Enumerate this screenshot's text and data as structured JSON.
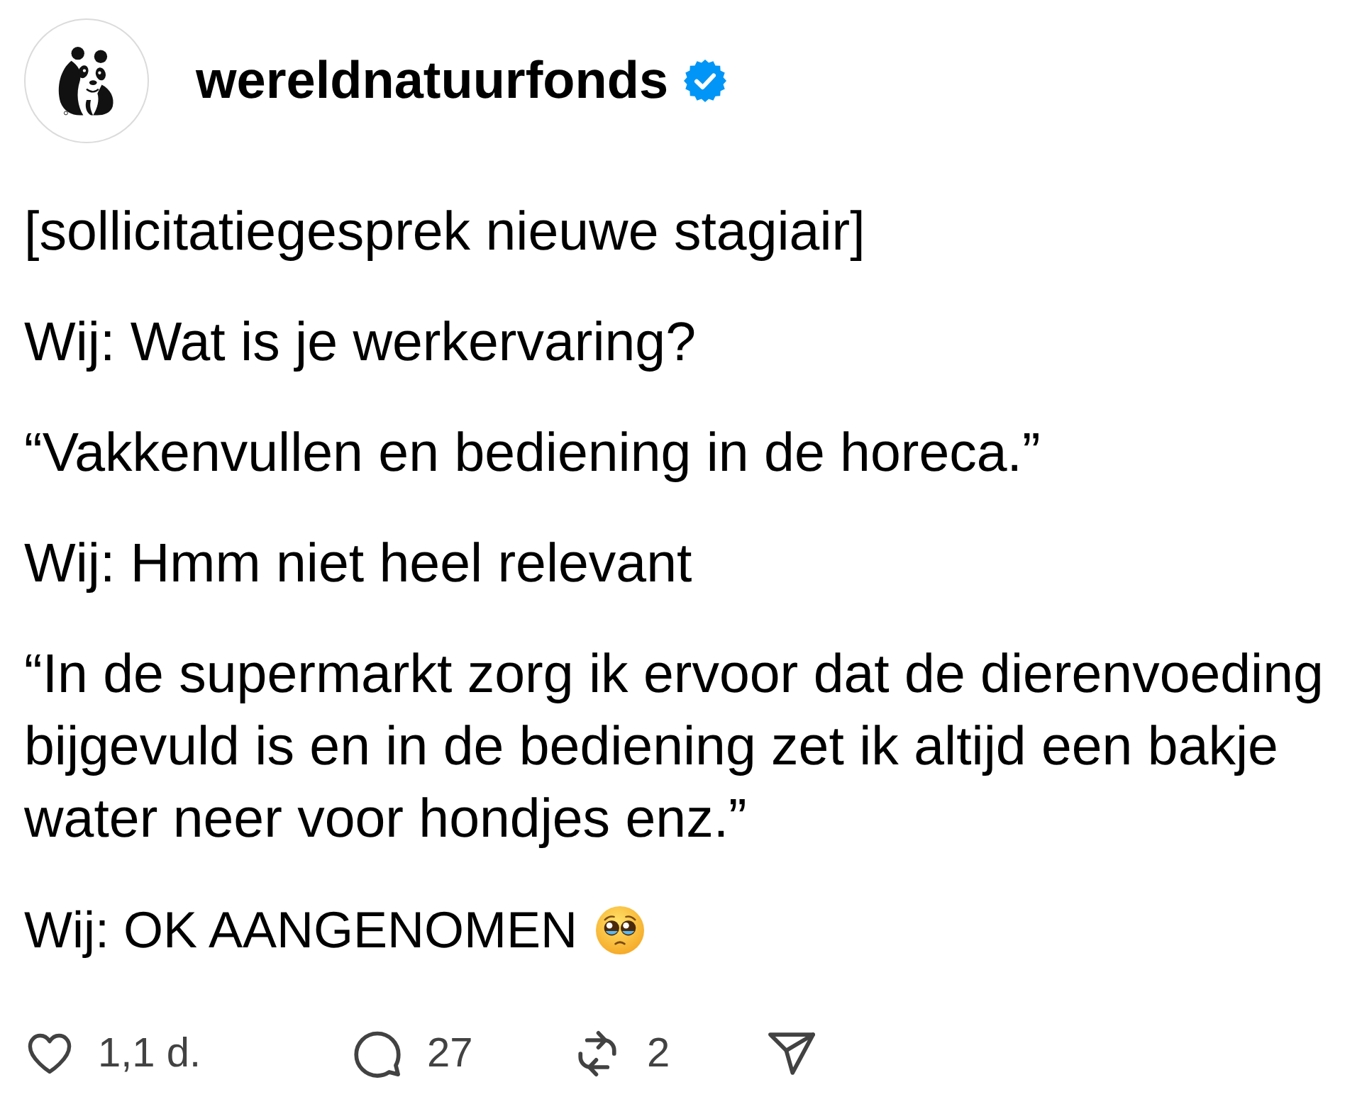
{
  "post": {
    "author": {
      "username": "wereldnatuurfonds",
      "verified": true
    },
    "paragraphs": [
      {
        "text": "[sollicitatiegesprek nieuwe stagiair]",
        "emoji": false
      },
      {
        "text": "Wij: Wat is je werkervaring?",
        "emoji": false
      },
      {
        "text": "“Vakkenvullen en bediening in de horeca.”",
        "emoji": false
      },
      {
        "text": "Wij: Hmm niet heel relevant",
        "emoji": false
      },
      {
        "text": "“In de supermarkt zorg ik ervoor dat de dierenvoeding bijgevuld is en in de bediening zet ik altijd een bakje water neer voor hondjes enz.”",
        "emoji": false
      },
      {
        "text": "Wij: OK AANGENOMEN",
        "emoji": true
      }
    ],
    "actions": [
      {
        "kind": "like",
        "count": "1,1 d."
      },
      {
        "kind": "comment",
        "count": "27"
      },
      {
        "kind": "repost",
        "count": "2"
      },
      {
        "kind": "share"
      }
    ]
  }
}
